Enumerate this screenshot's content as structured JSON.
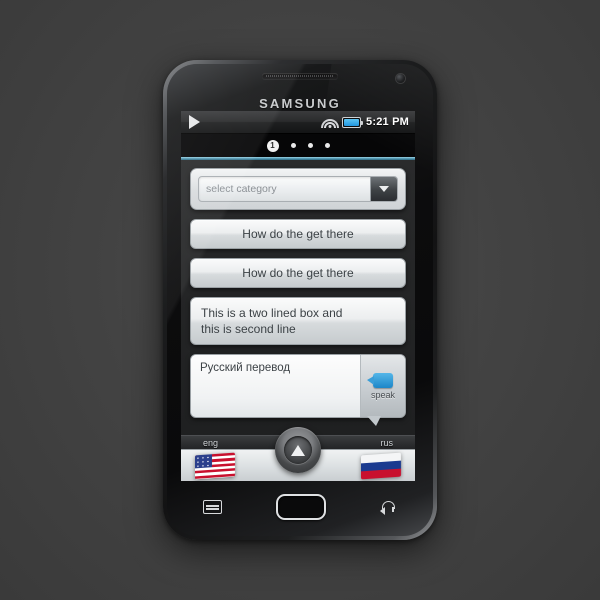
{
  "background": {
    "color": "#464646"
  },
  "device": {
    "brand": "SAMSUNG",
    "speaker_name": "earpiece-speaker",
    "camera_name": "front-camera"
  },
  "status_bar": {
    "left_icon": "play-icon",
    "wifi_icon": "wifi-icon",
    "battery_icon": "battery-icon",
    "battery_color": "#2196e0",
    "time": "5:21 PM"
  },
  "page_indicator": {
    "current": "1",
    "dots": [
      "",
      "",
      ""
    ]
  },
  "accent": {
    "divider_color": "#4e93ad"
  },
  "app": {
    "category_select": {
      "value": "select category",
      "placeholder": "select category",
      "arrow_icon": "chevron-down-icon"
    },
    "rows": [
      {
        "label": "How do the get there",
        "align": "center"
      },
      {
        "label": "How do the get there",
        "align": "center"
      }
    ],
    "two_line_box": {
      "line1": "This is a two lined box and",
      "line2": "this is second line"
    },
    "translation": {
      "text": "Русский перевод",
      "speak_label": "speak",
      "speak_icon": "speech-bubble-icon",
      "speak_icon_color": "#1c86c8"
    }
  },
  "language_bar": {
    "left": {
      "label": "eng",
      "flag": "flag-usa"
    },
    "right": {
      "label": "rus",
      "flag": "flag-russia"
    },
    "mic_button": {
      "icon": "triangle-up-icon"
    }
  },
  "hardware_buttons": {
    "menu": "menu-icon",
    "home": "home-button",
    "back": "back-icon"
  }
}
